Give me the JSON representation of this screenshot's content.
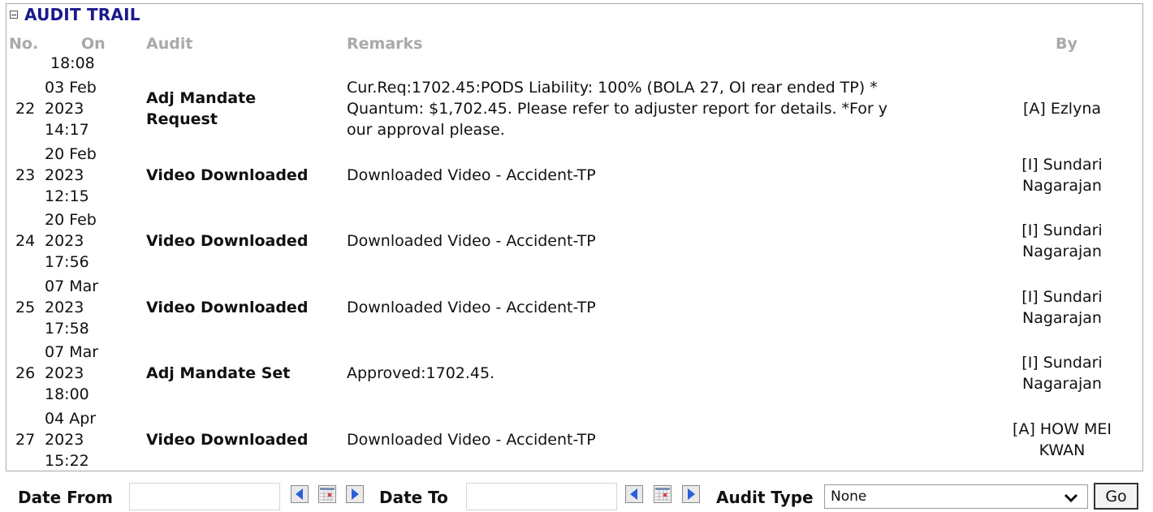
{
  "panel": {
    "title": "AUDIT TRAIL"
  },
  "columns": {
    "no": "No.",
    "on": "On",
    "audit": "Audit",
    "remarks": "Remarks",
    "by": "By"
  },
  "partial_time": "18:08",
  "rows": [
    {
      "no": "22",
      "date": "03 Feb",
      "year": "2023",
      "time": "14:17",
      "audit_l1": "Adj Mandate",
      "audit_l2": "Request",
      "remarks_l1": "Cur.Req:1702.45:PODS Liability: 100% (BOLA 27, OI rear ended TP) *",
      "remarks_l2": "Quantum: $1,702.45. Please refer to adjuster report for details. *For y",
      "remarks_l3": "our approval please.",
      "by_l1": "[A] Ezlyna",
      "by_l2": ""
    },
    {
      "no": "23",
      "date": "20 Feb",
      "year": "2023",
      "time": "12:15",
      "audit_l1": "Video Downloaded",
      "audit_l2": "",
      "remarks_l1": "Downloaded Video - Accident-TP",
      "remarks_l2": "",
      "remarks_l3": "",
      "by_l1": "[I] Sundari",
      "by_l2": "Nagarajan"
    },
    {
      "no": "24",
      "date": "20 Feb",
      "year": "2023",
      "time": "17:56",
      "audit_l1": "Video Downloaded",
      "audit_l2": "",
      "remarks_l1": "Downloaded Video - Accident-TP",
      "remarks_l2": "",
      "remarks_l3": "",
      "by_l1": "[I] Sundari",
      "by_l2": "Nagarajan"
    },
    {
      "no": "25",
      "date": "07 Mar",
      "year": "2023",
      "time": "17:58",
      "audit_l1": "Video Downloaded",
      "audit_l2": "",
      "remarks_l1": "Downloaded Video - Accident-TP",
      "remarks_l2": "",
      "remarks_l3": "",
      "by_l1": "[I] Sundari",
      "by_l2": "Nagarajan"
    },
    {
      "no": "26",
      "date": "07 Mar",
      "year": "2023",
      "time": "18:00",
      "audit_l1": "Adj Mandate Set",
      "audit_l2": "",
      "remarks_l1": "Approved:1702.45.",
      "remarks_l2": "",
      "remarks_l3": "",
      "by_l1": "[I] Sundari",
      "by_l2": "Nagarajan"
    },
    {
      "no": "27",
      "date": "04 Apr",
      "year": "2023",
      "time": "15:22",
      "audit_l1": "Video Downloaded",
      "audit_l2": "",
      "remarks_l1": "Downloaded Video - Accident-TP",
      "remarks_l2": "",
      "remarks_l3": "",
      "by_l1": "[A] HOW MEI",
      "by_l2": "KWAN"
    }
  ],
  "filter": {
    "date_from_label": "Date From",
    "date_to_label": "Date To",
    "audit_type_label": "Audit Type",
    "audit_type_value": "None",
    "go_label": "Go",
    "date_from_value": "",
    "date_to_value": ""
  },
  "icons": [
    "collapse-icon",
    "prev-arrow-icon",
    "calendar-icon",
    "next-arrow-icon",
    "chevron-down-icon"
  ],
  "colors": {
    "title": "#1a1a8c",
    "header_text": "#a9a9a9",
    "arrow": "#2b5fd9",
    "border": "#a9a9a9"
  }
}
